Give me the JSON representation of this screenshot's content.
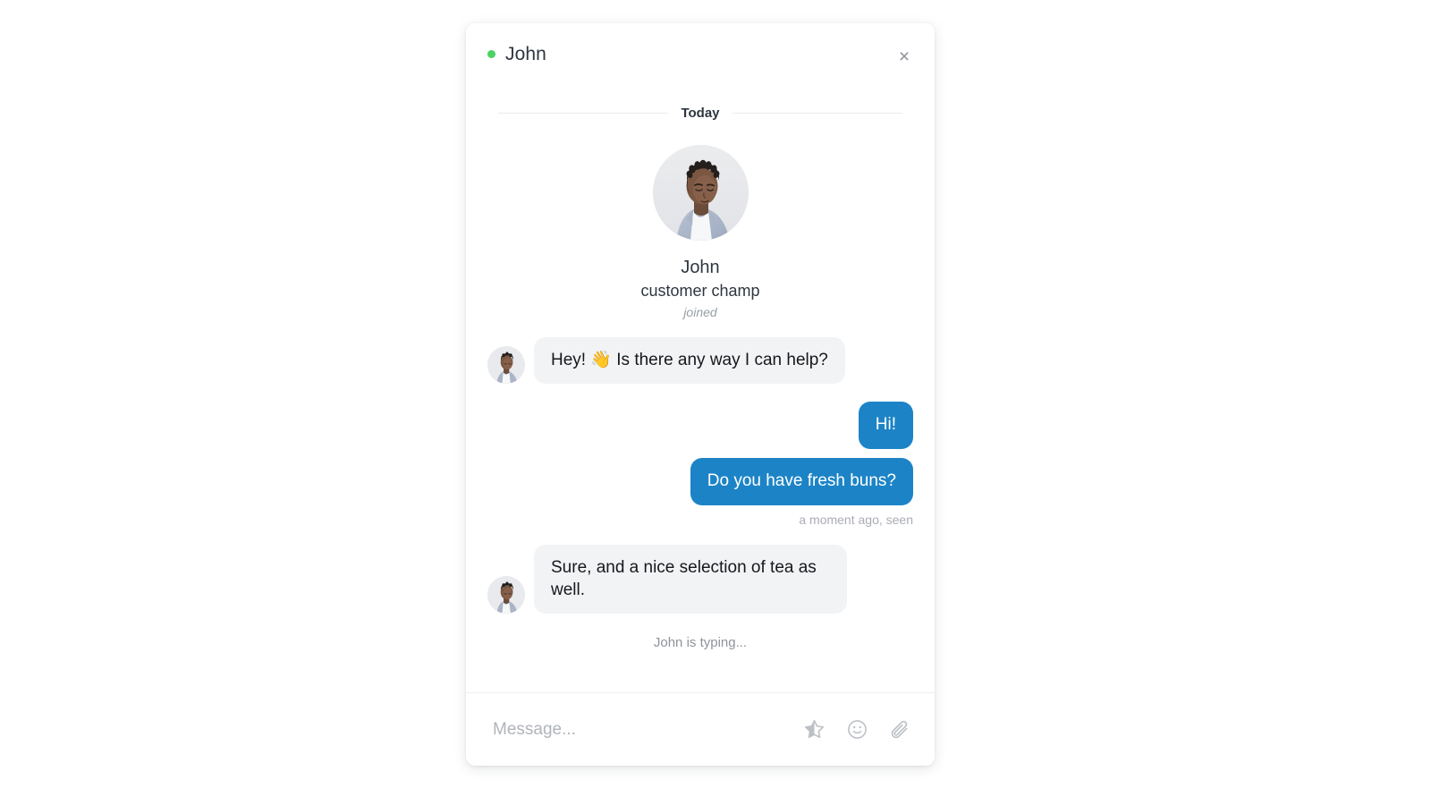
{
  "header": {
    "title": "John",
    "status_color": "#4cd263",
    "status_dot_name": "online-status-dot",
    "close_label": "×"
  },
  "conversation": {
    "day_divider": "Today",
    "profile": {
      "name": "John",
      "role": "customer champ",
      "joined_label": "joined",
      "avatar_alt": "John avatar"
    },
    "messages": [
      {
        "id": "m1",
        "direction": "incoming",
        "text": "Hey! 👋 Is there any way I can help?",
        "has_avatar": true
      },
      {
        "id": "m2",
        "direction": "outgoing",
        "text": "Hi!",
        "has_avatar": false
      },
      {
        "id": "m3",
        "direction": "outgoing",
        "text": "Do you have fresh buns?",
        "has_avatar": false
      },
      {
        "id": "m4",
        "direction": "incoming",
        "text": "Sure, and a nice selection of tea as well.",
        "has_avatar": true
      }
    ],
    "delivery_status": "a moment ago, seen",
    "typing_indicator": "John is typing..."
  },
  "composer": {
    "placeholder": "Message...",
    "value": "",
    "actions": [
      {
        "name": "rate-star-icon",
        "label": "Rate conversation"
      },
      {
        "name": "emoji-smiley-icon",
        "label": "Insert emoji"
      },
      {
        "name": "attachment-paperclip-icon",
        "label": "Attach file"
      }
    ]
  },
  "colors": {
    "outgoing_bubble": "#1c84c6",
    "incoming_bubble": "#f2f3f5",
    "online": "#4cd263",
    "muted_text": "#9aa0a6"
  }
}
